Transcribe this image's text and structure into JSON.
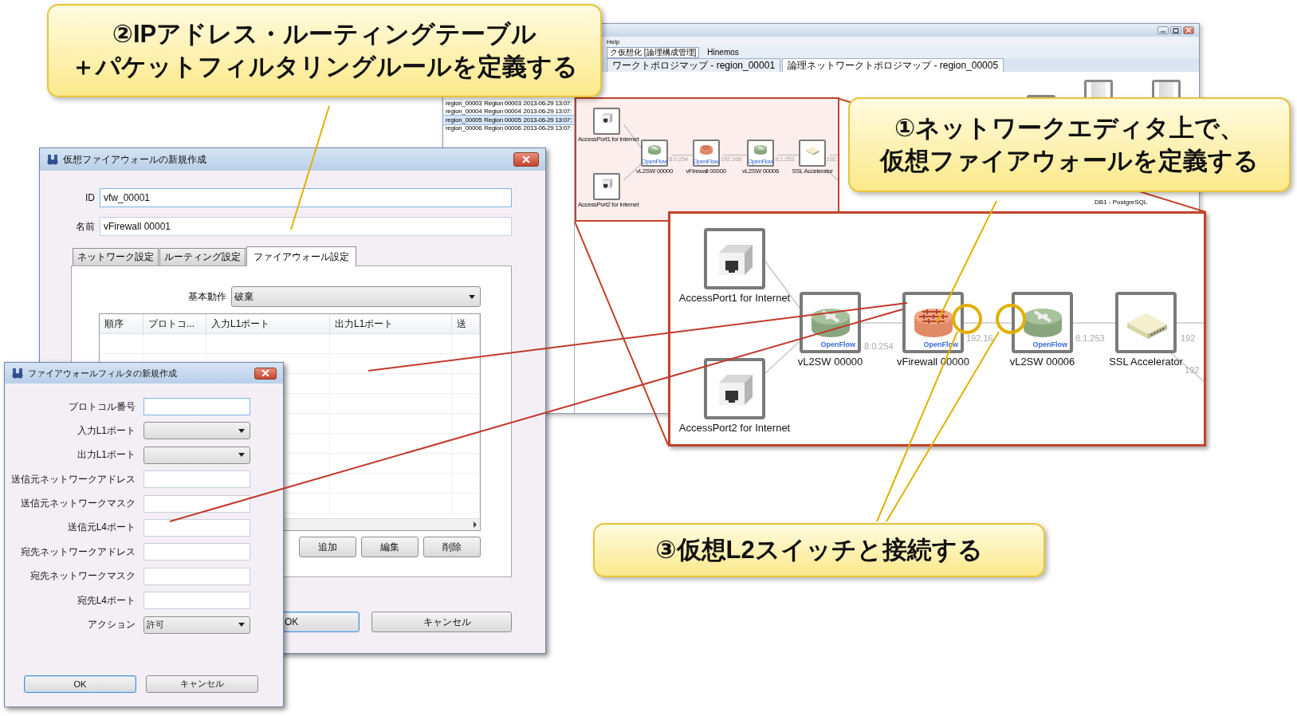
{
  "background_window": {
    "menu": [
      {
        "label": "Help"
      }
    ],
    "toolbar": [
      {
        "label": "ク仮想化 [論理構成管理]",
        "selected": true
      },
      {
        "label": "Hinemos",
        "selected": false
      }
    ],
    "editor_tabs": [
      {
        "label": "ワークトポロジマップ - region_00001",
        "selected": false
      },
      {
        "label": "論理ネットワークトポロジマップ - region_00005",
        "selected": true
      }
    ],
    "region_rows": [
      {
        "cells": [
          "region_00003",
          "Region 00003",
          "2013-06-29 13:07:"
        ],
        "selected": false
      },
      {
        "cells": [
          "region_00004",
          "Region 00004",
          "2013-06-29 13:07:"
        ],
        "selected": false
      },
      {
        "cells": [
          "region_00005",
          "Region 00005",
          "2013-06-29 13:07:"
        ],
        "selected": true
      },
      {
        "cells": [
          "region_00006",
          "Region 00006",
          "2013-06-29 13:07:"
        ],
        "selected": false
      }
    ],
    "server_label": "DB1 - PostgreSQL"
  },
  "inset_diagram": {
    "nodes": [
      {
        "kind": "port",
        "label": "AccessPort1 for Internet"
      },
      {
        "kind": "switch",
        "label": "vL2SW 00000",
        "badge": "OpenFlow"
      },
      {
        "kind": "firewall",
        "label": "vFirewall 00000",
        "badge": "OpenFlow"
      },
      {
        "kind": "switch",
        "label": "vL2SW 00006",
        "badge": "OpenFlow"
      },
      {
        "kind": "appliance",
        "label": "SSL Accelerator"
      },
      {
        "kind": "port",
        "label": "AccessPort2 for Internet"
      }
    ],
    "link_labels": [
      "8.0.254",
      "192.168",
      "8.1.253",
      "192."
    ]
  },
  "zoomed_diagram": {
    "nodes": [
      {
        "kind": "port",
        "label": "AccessPort1 for Internet"
      },
      {
        "kind": "switch",
        "label": "vL2SW 00000",
        "badge": "OpenFlow"
      },
      {
        "kind": "firewall",
        "label": "vFirewall 00000",
        "badge": "OpenFlow"
      },
      {
        "kind": "switch",
        "label": "vL2SW 00006",
        "badge": "OpenFlow"
      },
      {
        "kind": "appliance",
        "label": "SSL Accelerator"
      },
      {
        "kind": "port",
        "label": "AccessPort2 for Internet"
      }
    ],
    "link_labels": [
      "8.0.254",
      "192.16",
      "8.1.253",
      "192",
      "192"
    ]
  },
  "firewall_dialog": {
    "title": "仮想ファイアウォールの新規作成",
    "fields": [
      {
        "label": "ID",
        "value": "vfw_00001"
      },
      {
        "label": "名前",
        "value": "vFirewall 00001"
      }
    ],
    "tabs": [
      {
        "label": "ネットワーク設定",
        "selected": false
      },
      {
        "label": "ルーティング設定",
        "selected": false
      },
      {
        "label": "ファイアウォール設定",
        "selected": true
      }
    ],
    "default_action": {
      "label": "基本動作",
      "value": "破棄"
    },
    "table": {
      "columns": [
        "順序",
        "プロトコ...",
        "入力L1ポート",
        "出力L1ポート",
        "送"
      ]
    },
    "table_buttons": [
      "追加",
      "編集",
      "削除"
    ],
    "buttons": [
      "OK",
      "キャンセル"
    ]
  },
  "filter_dialog": {
    "title": "ファイアウォールフィルタの新規作成",
    "fields": [
      {
        "label": "プロトコル番号",
        "kind": "text"
      },
      {
        "label": "入力L1ポート",
        "kind": "select"
      },
      {
        "label": "出力L1ポート",
        "kind": "select"
      },
      {
        "label": "送信元ネットワークアドレス",
        "kind": "text"
      },
      {
        "label": "送信元ネットワークマスク",
        "kind": "text"
      },
      {
        "label": "送信元L4ポート",
        "kind": "text"
      },
      {
        "label": "宛先ネットワークアドレス",
        "kind": "text"
      },
      {
        "label": "宛先ネットワークマスク",
        "kind": "text"
      },
      {
        "label": "宛先L4ポート",
        "kind": "text"
      },
      {
        "label": "アクション",
        "kind": "select",
        "value": "許可"
      }
    ],
    "buttons": [
      "OK",
      "キャンセル"
    ]
  },
  "callouts": [
    {
      "lines": [
        "②IPアドレス・ルーティングテーブル",
        "＋パケットフィルタリングルールを定義する"
      ]
    },
    {
      "lines": [
        "①ネットワークエディタ上で、",
        "仮想ファイアウォールを定義する"
      ]
    },
    {
      "lines": [
        "③仮想L2スイッチと接続する"
      ]
    }
  ]
}
